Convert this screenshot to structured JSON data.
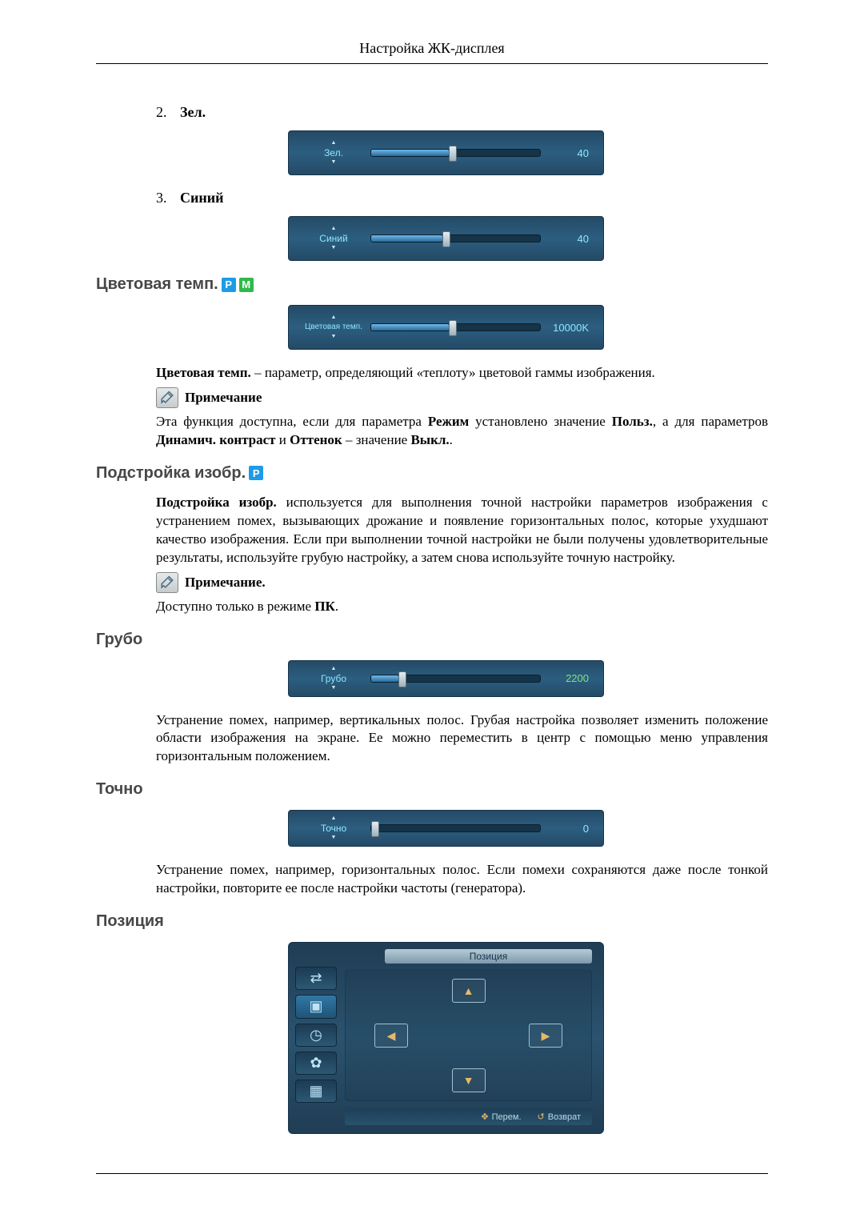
{
  "header": {
    "title": "Настройка ЖК-дисплея"
  },
  "colorList": {
    "items": [
      {
        "num": "2.",
        "label": "Зел."
      },
      {
        "num": "3.",
        "label": "Синий"
      }
    ]
  },
  "sliders": {
    "green": {
      "label": "Зел.",
      "value": "40",
      "percent": 40
    },
    "blue": {
      "label": "Синий",
      "value": "40",
      "percent": 40
    },
    "temp": {
      "label": "Цветовая темп.",
      "value": "10000K",
      "percent": 45
    },
    "coarse": {
      "label": "Грубо",
      "value": "2200",
      "percent": 13
    },
    "fine": {
      "label": "Точно",
      "value": "0",
      "percent": 0
    }
  },
  "sections": {
    "colorTemp": {
      "heading": "Цветовая темп.",
      "paraLead": "Цветовая темп.",
      "paraRest": " – параметр, определяющий «теплоту» цветовой гаммы изображения.",
      "noteLabel": "Примечание",
      "notePara1a": "Эта функция доступна, если для параметра ",
      "noteB1": "Режим",
      "notePara1b": " установлено значение ",
      "noteB2": "Польз.",
      "notePara1c": ", а для параметров ",
      "noteB3": "Динамич. контраст",
      "notePara1d": " и ",
      "noteB4": "Оттенок",
      "notePara1e": " – значение ",
      "noteB5": "Выкл.",
      "notePara1f": "."
    },
    "imageAdj": {
      "heading": "Подстройка изобр.",
      "paraLead": "Подстройка изобр.",
      "paraRest": " используется для выполнения точной настройки параметров изображения с устранением помех, вызывающих дрожание и появление горизонтальных полос, которые ухудшают качество изображения. Если при выполнении точной настройки не были получены удовлетворительные результаты, используйте грубую настройку, а затем снова используйте точную настройку.",
      "noteLabel": "Примечание.",
      "notePara2a": "Доступно только в режиме ",
      "noteB": "ПК",
      "notePara2b": "."
    },
    "coarse": {
      "heading": "Грубо",
      "para": "Устранение помех, например, вертикальных полос. Грубая настройка позволяет изменить положение области изображения на экране. Ее можно переместить в центр с помощью меню управления горизонтальным положением."
    },
    "fine": {
      "heading": "Точно",
      "para": "Устранение помех, например, горизонтальных полос. Если помехи сохраняются даже после тонкой настройки, повторите ее после настройки частоты (генератора)."
    },
    "position": {
      "heading": "Позиция",
      "menuTitle": "Позиция",
      "hintMove": "Перем.",
      "hintReturn": "Возврат"
    }
  }
}
